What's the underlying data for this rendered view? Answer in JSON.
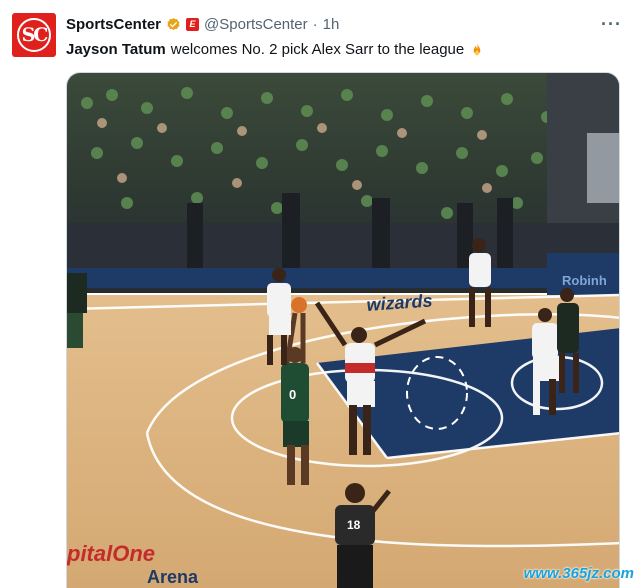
{
  "post": {
    "display_name": "SportsCenter",
    "handle": "@SportsCenter",
    "separator": "·",
    "time": "1h",
    "more_label": "···",
    "avatar_text": "SC",
    "text_mention": "Jayson Tatum",
    "text_body": "welcomes No. 2 pick Alex Sarr to the league",
    "icons": {
      "verified": "verified-badge-icon",
      "affiliate": "espn-affiliate-icon",
      "fire": "fire-emoji-icon",
      "more": "more-options-icon"
    }
  },
  "media": {
    "court_logo": "wizards",
    "baseline_ad": "Robinh",
    "arena_line1": "pitalOne",
    "arena_line2": "Arena",
    "jersey_tatum": "0",
    "referee_number": "18"
  },
  "watermark": "www.365jz.com",
  "colors": {
    "brand_red": "#e0201c",
    "court_blue": "#1e3a66",
    "court_wood": "#d9b07a",
    "verified_gold": "#e8a317"
  }
}
